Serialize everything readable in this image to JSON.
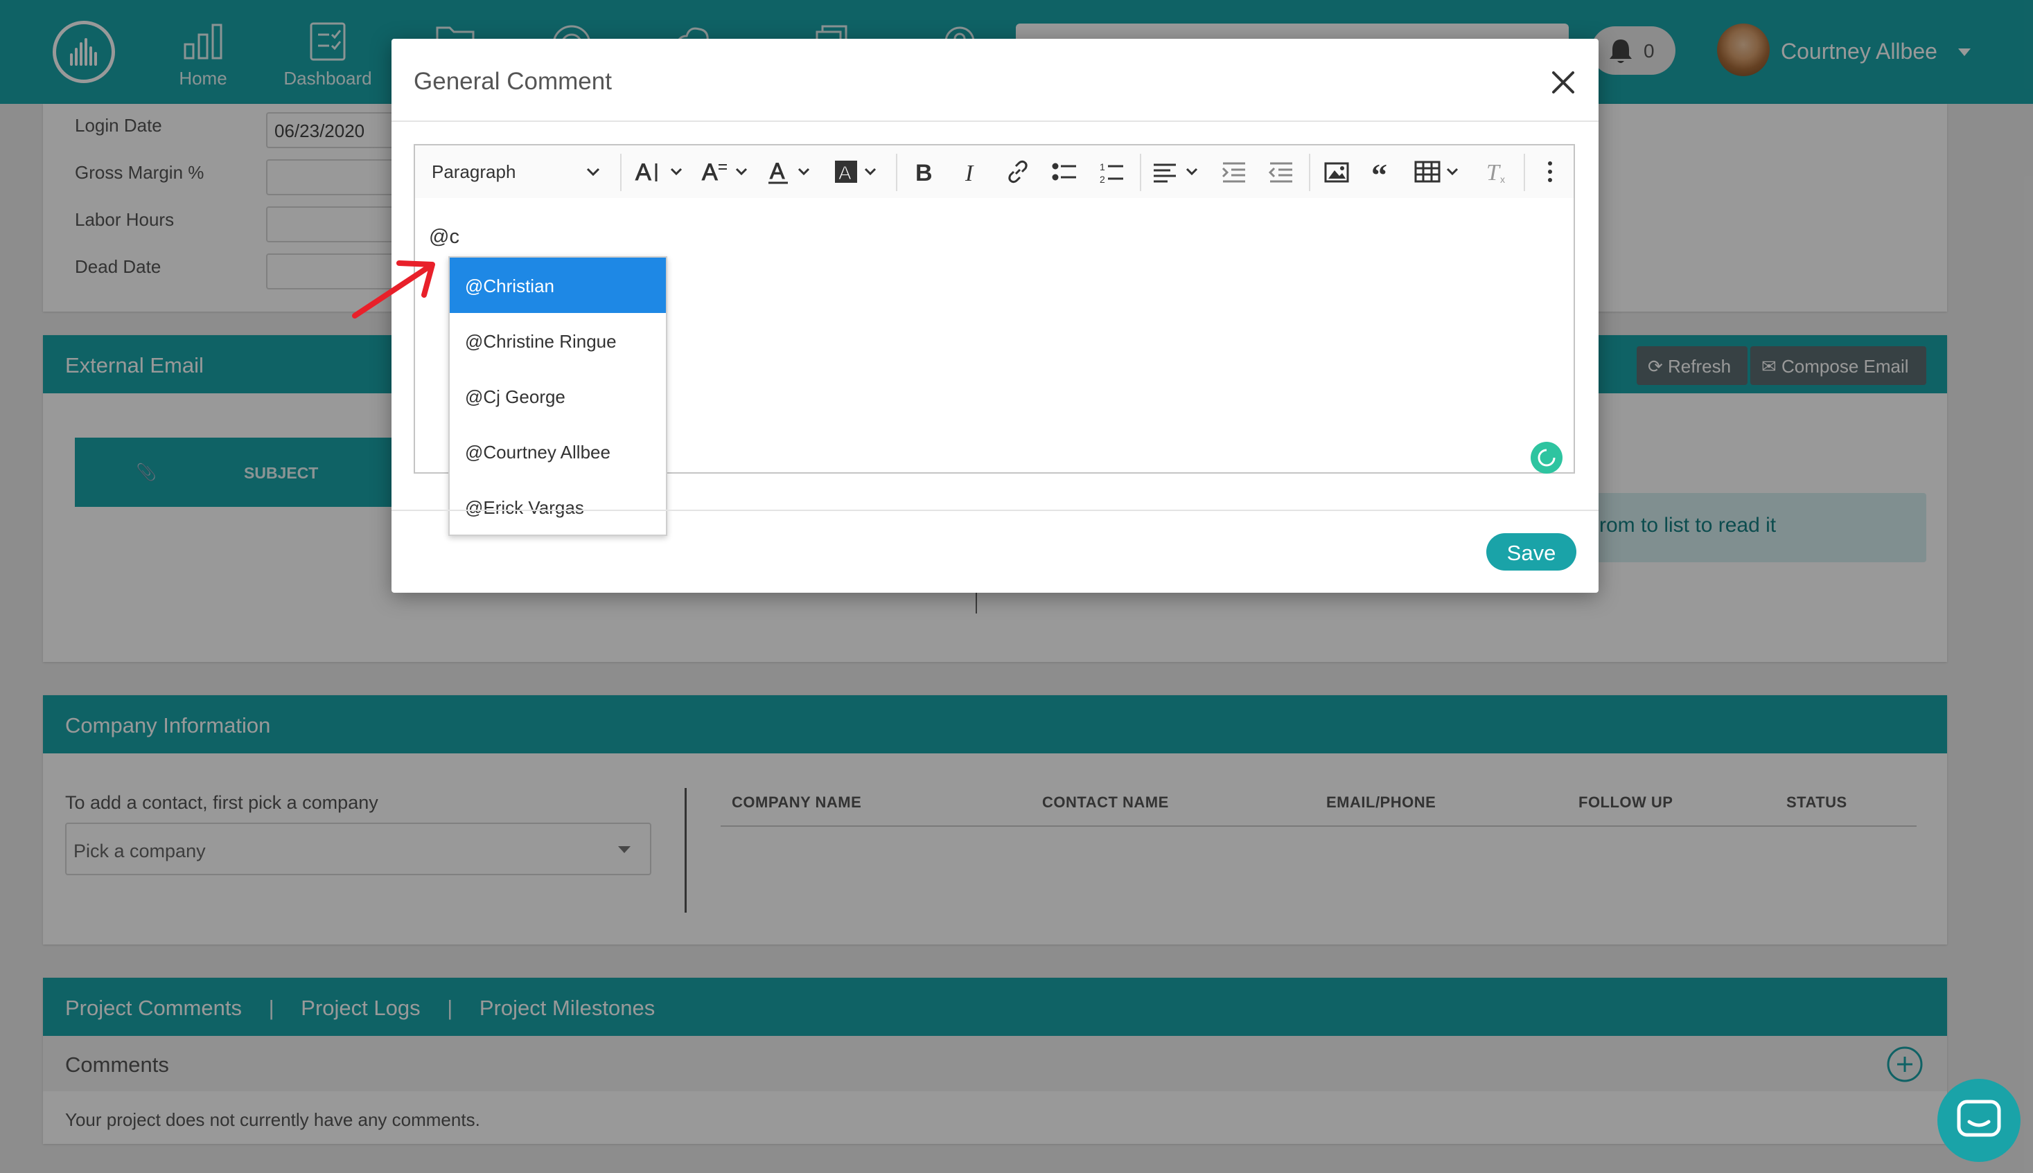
{
  "topbar": {
    "nav": [
      {
        "label": "Home",
        "icon": "bar-chart-icon"
      },
      {
        "label": "Dashboard",
        "icon": "clipboard-icon"
      },
      {
        "label": "",
        "icon": "folder-icon"
      },
      {
        "label": "",
        "icon": "target-icon"
      },
      {
        "label": "",
        "icon": "cloud-icon"
      },
      {
        "label": "",
        "icon": "copy-icon"
      },
      {
        "label": "",
        "icon": "search-icon"
      }
    ],
    "notifications": "0",
    "user": "Courtney Allbee"
  },
  "project_fields": {
    "login_date_label": "Login Date",
    "login_date_value": "06/23/2020",
    "gross_margin_label": "Gross Margin %",
    "labor_hours_label": "Labor Hours",
    "dead_date_label": "Dead Date"
  },
  "external_email": {
    "title": "External Email",
    "refresh": "Refresh",
    "compose": "Compose Email",
    "col_subject": "SUBJECT",
    "empty_hint": "rom to list to read it"
  },
  "company": {
    "title": "Company Information",
    "hint": "To add a contact, first pick a company",
    "select_placeholder": "Pick a company",
    "columns": [
      "COMPANY NAME",
      "CONTACT NAME",
      "EMAIL/PHONE",
      "FOLLOW UP",
      "STATUS"
    ]
  },
  "project_tabs": {
    "tabs": [
      "Project Comments",
      "Project Logs",
      "Project Milestones"
    ],
    "separator": "|",
    "comments_title": "Comments",
    "empty": "Your project does not currently have any comments."
  },
  "modal": {
    "title": "General Comment",
    "paragraph": "Paragraph",
    "editor_text": "@c",
    "mentions": [
      "@Christian",
      "@Christine Ringue",
      "@Cj George",
      "@Courtney Allbee",
      "@Erick Vargas"
    ],
    "save": "Save"
  },
  "colors": {
    "teal": "#1aa3a8",
    "selection": "#1e88e5",
    "annotation_arrow": "#e8202a"
  }
}
